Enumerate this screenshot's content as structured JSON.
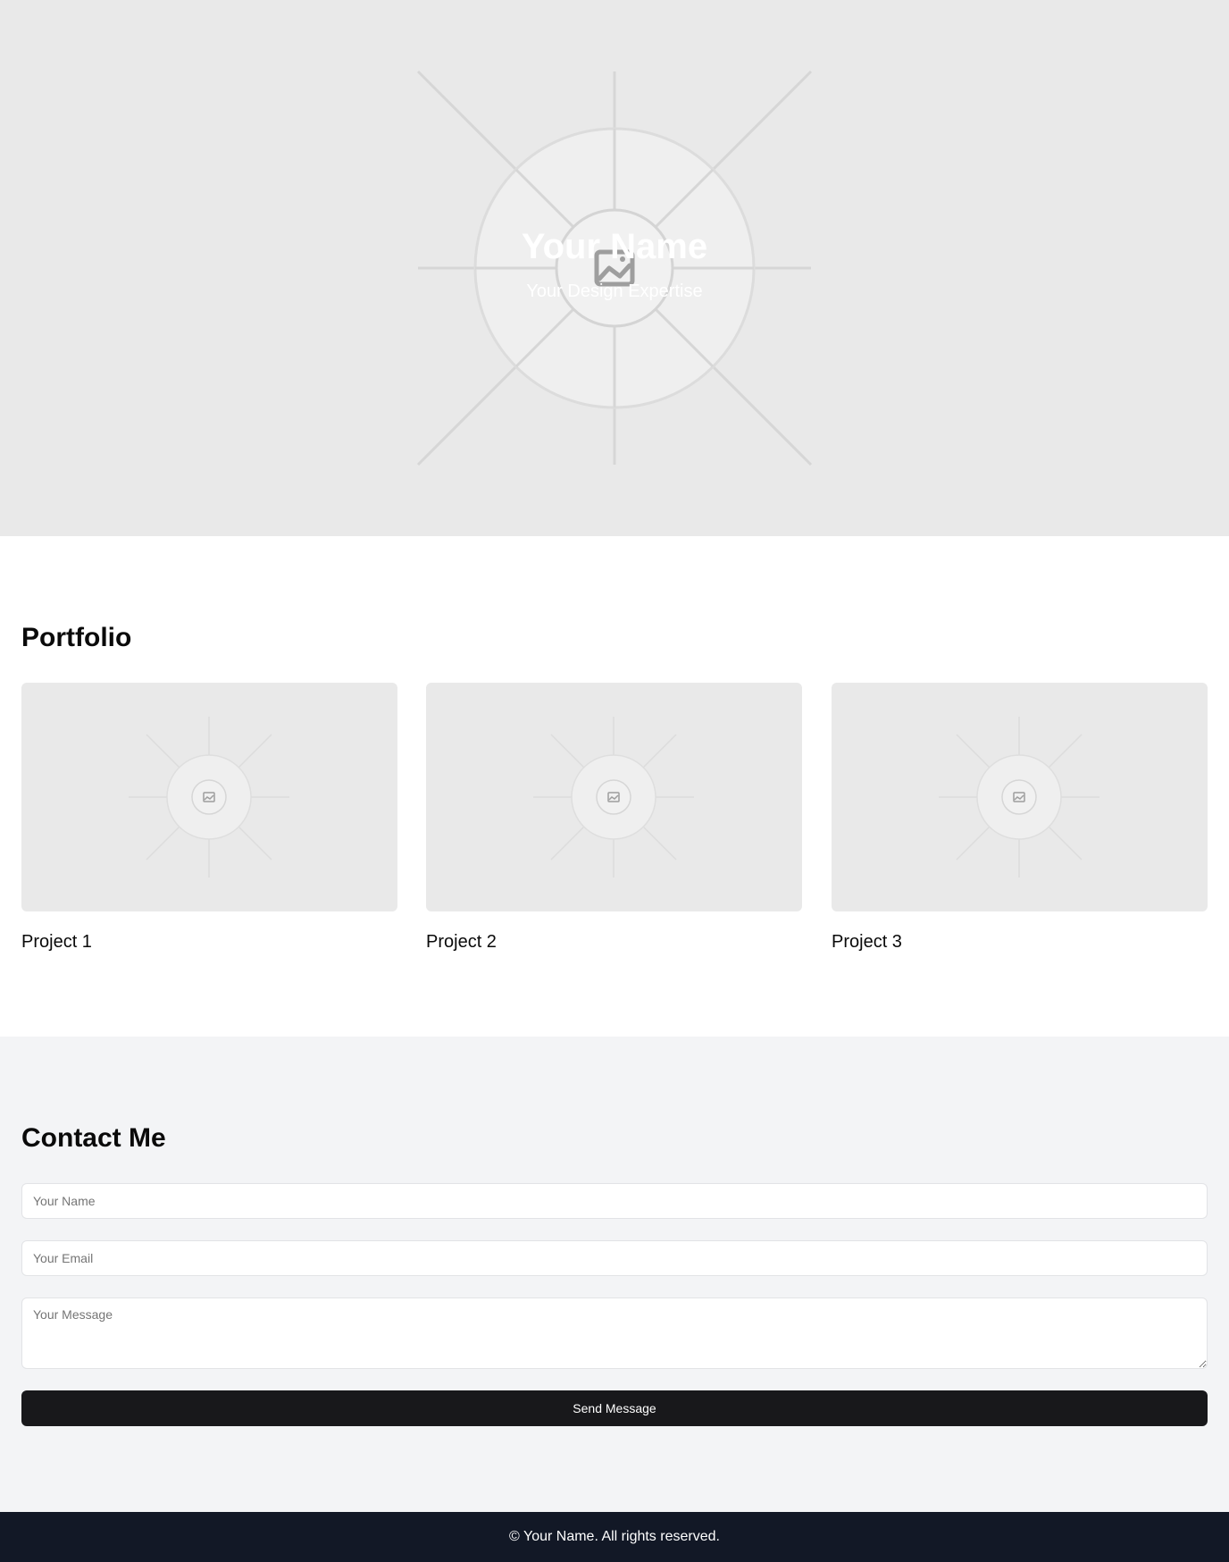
{
  "hero": {
    "title": "Your Name",
    "subtitle": "Your Design Expertise",
    "image_icon": "image-placeholder-icon"
  },
  "portfolio": {
    "title": "Portfolio",
    "projects": [
      {
        "title": "Project 1",
        "image_icon": "image-placeholder-icon"
      },
      {
        "title": "Project 2",
        "image_icon": "image-placeholder-icon"
      },
      {
        "title": "Project 3",
        "image_icon": "image-placeholder-icon"
      }
    ]
  },
  "contact": {
    "title": "Contact Me",
    "name_placeholder": "Your Name",
    "email_placeholder": "Your Email",
    "message_placeholder": "Your Message",
    "submit_label": "Send Message"
  },
  "footer": {
    "text": "© Your Name. All rights reserved."
  },
  "colors": {
    "hero_bg": "#e9e9e9",
    "contact_bg": "#f3f4f6",
    "button_bg": "#18181b",
    "footer_bg": "#121826"
  }
}
